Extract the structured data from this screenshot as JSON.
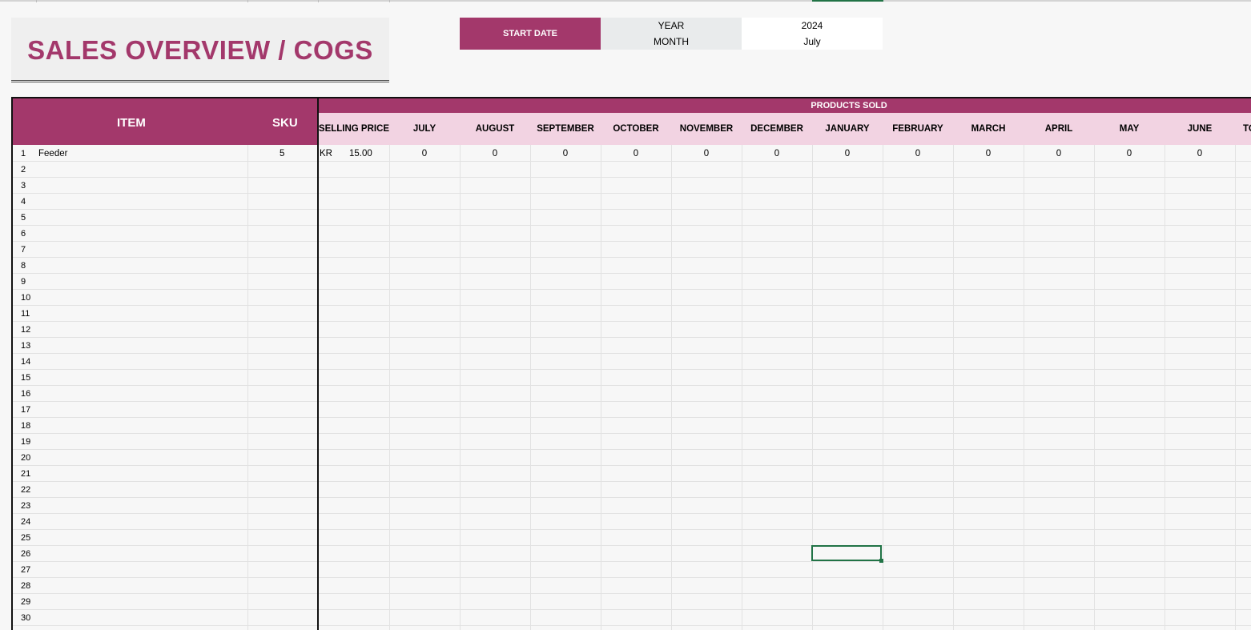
{
  "title": "SALES OVERVIEW / COGS",
  "start_date": {
    "label": "START DATE",
    "year_label": "YEAR",
    "year_value": "2024",
    "month_label": "MONTH",
    "month_value": "July"
  },
  "table": {
    "item_header": "ITEM",
    "sku_header": "SKU",
    "products_sold_header": "PRODUCTS SOLD",
    "columns": [
      "SELLING PRICE",
      "JULY",
      "AUGUST",
      "SEPTEMBER",
      "OCTOBER",
      "NOVEMBER",
      "DECEMBER",
      "JANUARY",
      "FEBRUARY",
      "MARCH",
      "APRIL",
      "MAY",
      "JUNE",
      "TO"
    ],
    "row_numbers": [
      "1",
      "2",
      "3",
      "4",
      "5",
      "6",
      "7",
      "8",
      "9",
      "10",
      "11",
      "12",
      "13",
      "14",
      "15",
      "16",
      "17",
      "18",
      "19",
      "20",
      "21",
      "22",
      "23",
      "24",
      "25",
      "26",
      "27",
      "28",
      "29",
      "30"
    ],
    "rows": [
      {
        "item": "Feeder",
        "sku": "5",
        "currency": "KR",
        "price": "15.00",
        "months": [
          "0",
          "0",
          "0",
          "0",
          "0",
          "0",
          "0",
          "0",
          "0",
          "0",
          "0",
          "0"
        ]
      }
    ]
  }
}
